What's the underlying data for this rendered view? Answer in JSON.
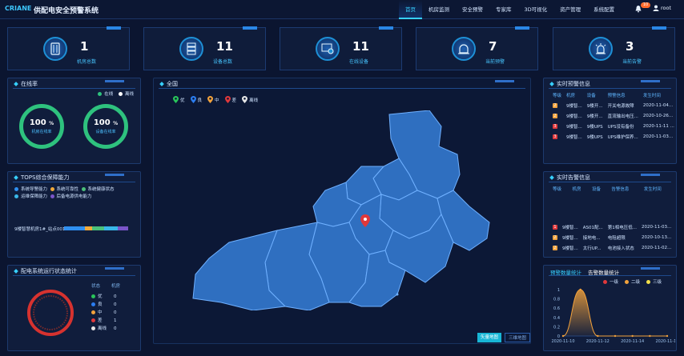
{
  "app": {
    "logo": "CRIANE",
    "logo_sub": "",
    "title": "供配电安全预警系统"
  },
  "nav": [
    "首页",
    "机房监测",
    "安全预警",
    "专家库",
    "3D可视化",
    "资产管理",
    "系统配置"
  ],
  "header": {
    "badge": "10",
    "user": "root"
  },
  "stats": [
    {
      "value": "1",
      "label": "机房总数",
      "icon": "server-rack-icon"
    },
    {
      "value": "11",
      "label": "设备总数",
      "icon": "device-stack-icon"
    },
    {
      "value": "11",
      "label": "在线设备",
      "icon": "online-device-icon"
    },
    {
      "value": "7",
      "label": "当前预警",
      "icon": "warning-light-icon"
    },
    {
      "value": "3",
      "label": "当前告警",
      "icon": "alarm-light-icon"
    }
  ],
  "online": {
    "title": "在线率",
    "legend": [
      "在线",
      "离线"
    ],
    "rings": [
      {
        "value": "100",
        "unit": "%",
        "label": "机房在线率"
      },
      {
        "value": "100",
        "unit": "%",
        "label": "设备在线率"
      }
    ]
  },
  "tops": {
    "title": "TOPS综合保障能力",
    "legend": [
      {
        "label": "系统导警能力",
        "color": "#2f8ff0"
      },
      {
        "label": "系统可靠性",
        "color": "#f0a93a"
      },
      {
        "label": "系统健康状态",
        "color": "#4bc07a"
      },
      {
        "label": "运维保障能力",
        "color": "#39b7e8"
      },
      {
        "label": "后备电源供电能力",
        "color": "#7a55c9"
      }
    ],
    "row_label": "9楼智慧机房1#_站点001",
    "segments": [
      0.32,
      0.12,
      0.18,
      0.22,
      0.16
    ]
  },
  "status": {
    "title": "配电系统运行状态统计",
    "col_state": "状态",
    "col_room": "机房",
    "rows": [
      {
        "label": "优",
        "count": "0",
        "color": "#29c55a"
      },
      {
        "label": "良",
        "count": "0",
        "color": "#2b7df0"
      },
      {
        "label": "中",
        "count": "0",
        "color": "#f2a23c"
      },
      {
        "label": "差",
        "count": "1",
        "color": "#e0383b"
      },
      {
        "label": "离线",
        "count": "0",
        "color": "#e6e6e6"
      }
    ]
  },
  "map": {
    "title": "全国",
    "legend": [
      {
        "label": "优",
        "color": "#29c55a"
      },
      {
        "label": "良",
        "color": "#2b7df0"
      },
      {
        "label": "中",
        "color": "#f2a23c"
      },
      {
        "label": "差",
        "color": "#e0383b"
      },
      {
        "label": "离线",
        "color": "#e6e6e6"
      }
    ],
    "btn_vector": "矢量地图",
    "btn_3d": "三维地图"
  },
  "warn": {
    "title": "实时预警信息",
    "headers": [
      "等级",
      "机房",
      "设备",
      "预警信息",
      "发生时间"
    ],
    "rows": [
      {
        "lvl": "2",
        "color": "#f2a23c",
        "room": "9楼智...",
        "dev": "9楼开...",
        "info": "开关电源故障",
        "time": "2020-11-04..."
      },
      {
        "lvl": "2",
        "color": "#f2a23c",
        "room": "9楼智...",
        "dev": "9楼开...",
        "info": "直流输出电压...",
        "time": "2020-10-26..."
      },
      {
        "lvl": "3",
        "color": "#e0383b",
        "room": "9楼智...",
        "dev": "9楼UPS",
        "info": "UPS没有备份",
        "time": "2020-11-11 ..."
      },
      {
        "lvl": "3",
        "color": "#e0383b",
        "room": "9楼智...",
        "dev": "9楼UPS",
        "info": "UPS维护保养...",
        "time": "2020-11-03..."
      }
    ]
  },
  "alarm": {
    "title": "实时告警信息",
    "headers": [
      "等级",
      "机房",
      "设备",
      "告警信息",
      "发生时间"
    ],
    "rows": [
      {
        "lvl": "1",
        "color": "#e0383b",
        "room": "9楼智...",
        "dev": "AS01配...",
        "info": "第1相电压低...",
        "time": "2020-11-03..."
      },
      {
        "lvl": "2",
        "color": "#f2a23c",
        "room": "9楼智...",
        "dev": "接地电...",
        "info": "电阻超限",
        "time": "2020-10-13..."
      },
      {
        "lvl": "2",
        "color": "#f2a23c",
        "room": "9楼智...",
        "dev": "太行UP...",
        "info": "电池接入状态",
        "time": "2020-11-02..."
      }
    ]
  },
  "chart_panel": {
    "tab_warn": "预警数量统计",
    "tab_alarm": "告警数量统计",
    "legend": [
      {
        "label": "一级",
        "color": "#e0383b"
      },
      {
        "label": "二级",
        "color": "#f2a23c"
      },
      {
        "label": "三级",
        "color": "#f3e04a"
      }
    ]
  },
  "chart_data": {
    "type": "area",
    "x": [
      "2020-11-10",
      "2020-11-11",
      "2020-11-12",
      "2020-11-13",
      "2020-11-14",
      "2020-11-15",
      "2020-11-16"
    ],
    "x_ticks": [
      "2020-11-10",
      "2020-11-12",
      "2020-11-14",
      "2020-11-16"
    ],
    "series": [
      {
        "name": "二级",
        "values": [
          0,
          1,
          0,
          0,
          0,
          0,
          0
        ]
      }
    ],
    "ylim": [
      0,
      1
    ],
    "yticks": [
      "0",
      "0.2",
      "0.4",
      "0.6",
      "0.8",
      "1"
    ]
  }
}
